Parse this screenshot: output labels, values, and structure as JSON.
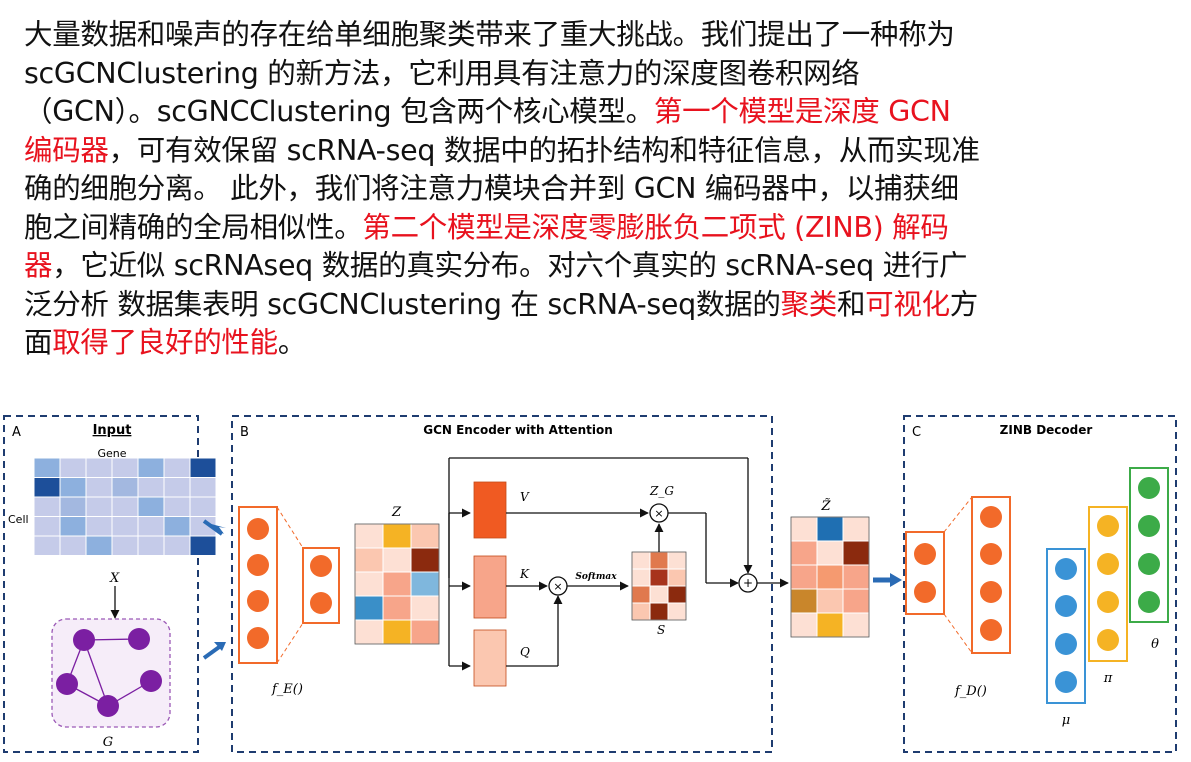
{
  "paragraph": {
    "lines": [
      [
        {
          "t": "大量数据和噪声的存在给单细胞聚类带来了重大挑战。我们提出了一种称为",
          "red": false
        }
      ],
      [
        {
          "t": "scGCNClustering 的新方法，它利用具有注意力的深度图卷积网络",
          "red": false
        }
      ],
      [
        {
          "t": "（GCN）。scGNCClustering 包含两个核心模型。",
          "red": false
        },
        {
          "t": "第一个模型是深度 GCN",
          "red": true
        }
      ],
      [
        {
          "t": "编码器",
          "red": true
        },
        {
          "t": "，可有效保留 scRNA-seq 数据中的拓扑结构和特征信息，从而实现准",
          "red": false
        }
      ],
      [
        {
          "t": "确的细胞分离。 此外，我们将注意力模块合并到 GCN 编码器中，以捕获细",
          "red": false
        }
      ],
      [
        {
          "t": "胞之间精确的全局相似性。",
          "red": false
        },
        {
          "t": "第二个模型是深度零膨胀负二项式 (ZINB) 解码",
          "red": true
        }
      ],
      [
        {
          "t": "器",
          "red": true
        },
        {
          "t": "，它近似 scRNAseq 数据的真实分布。对六个真实的 scRNA-seq 进行广",
          "red": false
        }
      ],
      [
        {
          "t": "泛分析 数据集表明 scGCNClustering 在 scRNA-seq数据的",
          "red": false
        },
        {
          "t": "聚类",
          "red": true
        },
        {
          "t": "和",
          "red": false
        },
        {
          "t": "可视化",
          "red": true
        },
        {
          "t": "方",
          "red": false
        }
      ],
      [
        {
          "t": "面",
          "red": false
        },
        {
          "t": "取得了良好的性能",
          "red": true
        },
        {
          "t": "。",
          "red": false
        }
      ]
    ]
  },
  "diagram": {
    "panel_a": {
      "letter": "A",
      "title": "Input",
      "gene_label": "Gene",
      "cell_label": "Cell",
      "x_label": "X",
      "g_label": "G"
    },
    "panel_b": {
      "letter": "B",
      "title": "GCN Encoder with Attention",
      "fe_label": "f_E()",
      "z_label": "Z",
      "v_label": "V",
      "k_label": "K",
      "q_label": "Q",
      "zg_label": "Z_G",
      "softmax_label": "Softmax",
      "s_label": "S"
    },
    "ztilde_label": "Z̃",
    "panel_c": {
      "letter": "C",
      "title": "ZINB Decoder",
      "fd_label": "f_D()",
      "mu_label": "μ",
      "pi_label": "π",
      "theta_label": "θ"
    },
    "colors": {
      "orange": "#f26a2a",
      "blue_node": "#3a93d6",
      "yellow_node": "#f5b324",
      "green_node": "#3cab48",
      "purple_node": "#7b1fa2",
      "dash_blue": "#1f3c70"
    },
    "input_matrix": [
      [
        1,
        0,
        0,
        0,
        1,
        0,
        3
      ],
      [
        3,
        1,
        0,
        2,
        0,
        0,
        0
      ],
      [
        0,
        2,
        0,
        0,
        1,
        0,
        0
      ],
      [
        0,
        1,
        0,
        0,
        0,
        1,
        0
      ],
      [
        0,
        0,
        1,
        0,
        0,
        0,
        3
      ]
    ],
    "z_matrix": [
      [
        "#fde0d4",
        "#f5b324",
        "#fbc7b0"
      ],
      [
        "#fbc7b0",
        "#fde0d4",
        "#8b2a0e"
      ],
      [
        "#fde0d4",
        "#f7a58a",
        "#7fb7dd"
      ],
      [
        "#3a8fc8",
        "#f7a58a",
        "#fde0d4"
      ],
      [
        "#fde0d4",
        "#f5b324",
        "#f7a58a"
      ]
    ],
    "s_matrix": [
      [
        "#fde0d4",
        "#e0794e",
        "#fde0d4"
      ],
      [
        "#fde0d4",
        "#a7331c",
        "#fbc7b0"
      ],
      [
        "#e0794e",
        "#fde0d4",
        "#8b2a0e"
      ],
      [
        "#fbc7b0",
        "#8b2a0e",
        "#fde0d4"
      ]
    ],
    "ztilde_matrix": [
      [
        "#fde0d4",
        "#1f6fb2",
        "#fde0d4"
      ],
      [
        "#f7a58a",
        "#fde0d4",
        "#8b2a0e"
      ],
      [
        "#f7a58a",
        "#f59a70",
        "#f7a58a"
      ],
      [
        "#c9862b",
        "#fbc7b0",
        "#f7a58a"
      ],
      [
        "#fde0d4",
        "#f5b324",
        "#fde0d4"
      ]
    ]
  }
}
